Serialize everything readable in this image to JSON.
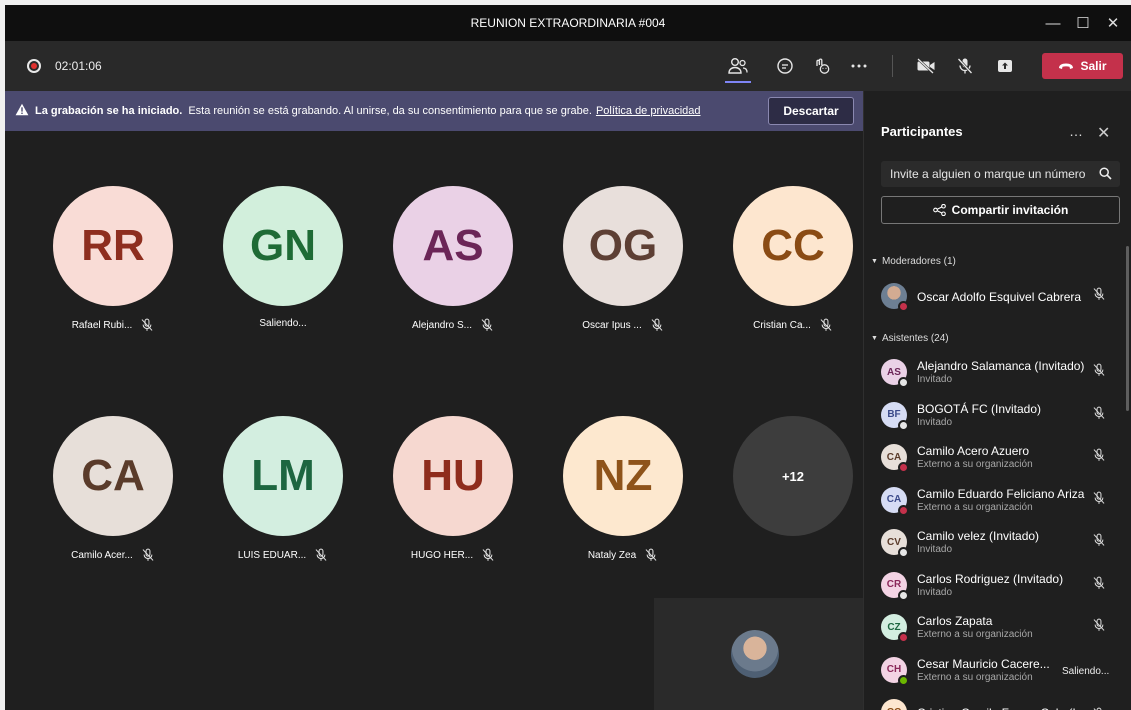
{
  "window": {
    "title": "REUNION EXTRAORDINARIA #004"
  },
  "toolbar": {
    "timer": "02:01:06",
    "leave_label": "Salir"
  },
  "banner": {
    "bold": "La grabación se ha iniciado.",
    "text": "Esta reunión se está grabando. Al unirse, da su consentimiento para que se grabe.",
    "link": "Política de privacidad",
    "dismiss": "Descartar"
  },
  "tiles": [
    {
      "initials": "RR",
      "name": "Rafael Rubi...",
      "bg": "#f9dcd6",
      "fg": "#8e2e1f",
      "muted": true
    },
    {
      "initials": "GN",
      "name": "Saliendo...",
      "bg": "#d2efdc",
      "fg": "#1e6b35",
      "muted": false
    },
    {
      "initials": "AS",
      "name": "Alejandro S...",
      "bg": "#ead1e6",
      "fg": "#6b2557",
      "muted": true
    },
    {
      "initials": "OG",
      "name": "Oscar Ipus ...",
      "bg": "#e8dfdb",
      "fg": "#5d3f34",
      "muted": true
    },
    {
      "initials": "CC",
      "name": "Cristian Ca...",
      "bg": "#fde6cf",
      "fg": "#8a4b14",
      "muted": true
    },
    {
      "initials": "CA",
      "name": "Camilo Acer...",
      "bg": "#e7dfd9",
      "fg": "#5a3b2a",
      "muted": true
    },
    {
      "initials": "LM",
      "name": "LUIS EDUAR...",
      "bg": "#d3eee0",
      "fg": "#1d6640",
      "muted": true
    },
    {
      "initials": "HU",
      "name": "HUGO HER...",
      "bg": "#f6d8d0",
      "fg": "#8f2c1c",
      "muted": true
    },
    {
      "initials": "NZ",
      "name": "Nataly Zea",
      "bg": "#fde8cf",
      "fg": "#8e531a",
      "muted": true
    }
  ],
  "overflow_tile": {
    "label": "+12"
  },
  "panel": {
    "title": "Participantes",
    "search_placeholder": "Invite a alguien o marque un número",
    "share_label": "Compartir invitación",
    "moderators_label": "Moderadores (1)",
    "attendees_label": "Asistentes (24)",
    "moderator": {
      "name": "Oscar Adolfo Esquivel Cabrera"
    },
    "attendees": [
      {
        "initials": "AS",
        "name": "Alejandro Salamanca (Invitado)",
        "sub": "Invitado",
        "bg": "#ead1e6",
        "fg": "#6b2557",
        "presence": "#e6e6e6",
        "status": ""
      },
      {
        "initials": "BF",
        "name": "BOGOTÁ FC (Invitado)",
        "sub": "Invitado",
        "bg": "#d6dcf4",
        "fg": "#3b4a8a",
        "presence": "#e6e6e6",
        "status": ""
      },
      {
        "initials": "CA",
        "name": "Camilo Acero Azuero",
        "sub": "Externo a su organización",
        "bg": "#e7dfd9",
        "fg": "#5a3b2a",
        "presence": "#c4314b",
        "status": ""
      },
      {
        "initials": "CA",
        "name": "Camilo Eduardo Feliciano Ariza",
        "sub": "Externo a su organización",
        "bg": "#d6dcf4",
        "fg": "#3b4a8a",
        "presence": "#c4314b",
        "status": ""
      },
      {
        "initials": "CV",
        "name": "Camilo velez (Invitado)",
        "sub": "Invitado",
        "bg": "#e7dfd9",
        "fg": "#5a3b2a",
        "presence": "#e6e6e6",
        "status": ""
      },
      {
        "initials": "CR",
        "name": "Carlos Rodriguez (Invitado)",
        "sub": "Invitado",
        "bg": "#f3d3e4",
        "fg": "#8a2659",
        "presence": "#e6e6e6",
        "status": ""
      },
      {
        "initials": "CZ",
        "name": "Carlos Zapata",
        "sub": "Externo a su organización",
        "bg": "#d3eee0",
        "fg": "#1d6640",
        "presence": "#c4314b",
        "status": ""
      },
      {
        "initials": "CH",
        "name": "Cesar Mauricio Cacere...",
        "sub": "Externo a su organización",
        "bg": "#f3d3e4",
        "fg": "#8a2659",
        "presence": "#6bb700",
        "status": "Saliendo..."
      },
      {
        "initials": "CC",
        "name": "Cristian Camilo Forero Cala (I...",
        "sub": "",
        "bg": "#fde6cf",
        "fg": "#8a4b14",
        "presence": "#e6e6e6",
        "status": ""
      }
    ]
  },
  "colors": {
    "leave": "#c4314b",
    "banner": "#4b4a6f",
    "accent": "#7f85f5"
  }
}
